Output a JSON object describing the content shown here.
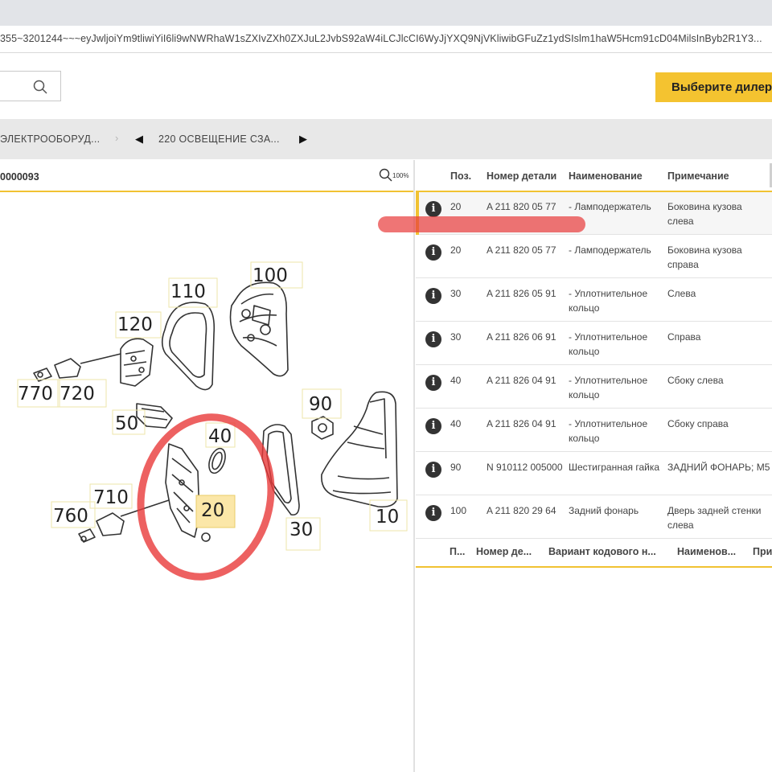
{
  "browser": {
    "url": "355~3201244~~~eyJwljoiYm9tliwiYiI6li9wNWRhaW1sZXIvZXh0ZXJuL2JvbS92aW4iLCJlcCI6WyJjYXQ9NjVKliwibGFuZz1ydSIslm1haW5Hcm91cD04MilsInByb2R1Y3..."
  },
  "header": {
    "dealer_button": "Выберите дилер"
  },
  "breadcrumb": {
    "group": "ЭЛЕКТРООБОРУД...",
    "subgroup": "220 ОСВЕЩЕНИЕ СЗА...",
    "prev": "◀",
    "next": "▶",
    "separator": "›"
  },
  "diagram": {
    "id": "0000093",
    "zoom": "100%",
    "callouts": [
      "100",
      "110",
      "120",
      "770",
      "720",
      "90",
      "50",
      "40",
      "710",
      "760",
      "20",
      "30",
      "10"
    ],
    "highlighted_callout": "20"
  },
  "parts_table": {
    "columns": [
      "Поз.",
      "Номер детали",
      "Наименование",
      "Примечание"
    ],
    "rows": [
      {
        "pos": "20",
        "number": "A 211 820 05 77",
        "name": "- Ламподержатель",
        "note": "Боковина кузова слева"
      },
      {
        "pos": "20",
        "number": "A 211 820 05 77",
        "name": "- Ламподержатель",
        "note": "Боковина кузова справа"
      },
      {
        "pos": "30",
        "number": "A 211 826 05 91",
        "name": "- Уплотнительное кольцо",
        "note": "Слева"
      },
      {
        "pos": "30",
        "number": "A 211 826 06 91",
        "name": "- Уплотнительное кольцо",
        "note": "Справа"
      },
      {
        "pos": "40",
        "number": "A 211 826 04 91",
        "name": "- Уплотнительное кольцо",
        "note": "Сбоку слева"
      },
      {
        "pos": "40",
        "number": "A 211 826 04 91",
        "name": "- Уплотнительное кольцо",
        "note": "Сбоку справа"
      },
      {
        "pos": "90",
        "number": "N 910112 005000",
        "name": "Шестигранная гайка",
        "note": "ЗАДНИЙ ФОНАРЬ; M5"
      },
      {
        "pos": "100",
        "number": "A 211 820 29 64",
        "name": "Задний фонарь",
        "note": "Дверь задней стенки слева"
      }
    ],
    "info_icon": "i"
  },
  "code_table": {
    "columns": [
      "П...",
      "Номер де...",
      "Вариант кодового н...",
      "Наименов...",
      "При"
    ]
  },
  "colors": {
    "accent": "#f1c232",
    "annotation": "#e83a3a"
  }
}
